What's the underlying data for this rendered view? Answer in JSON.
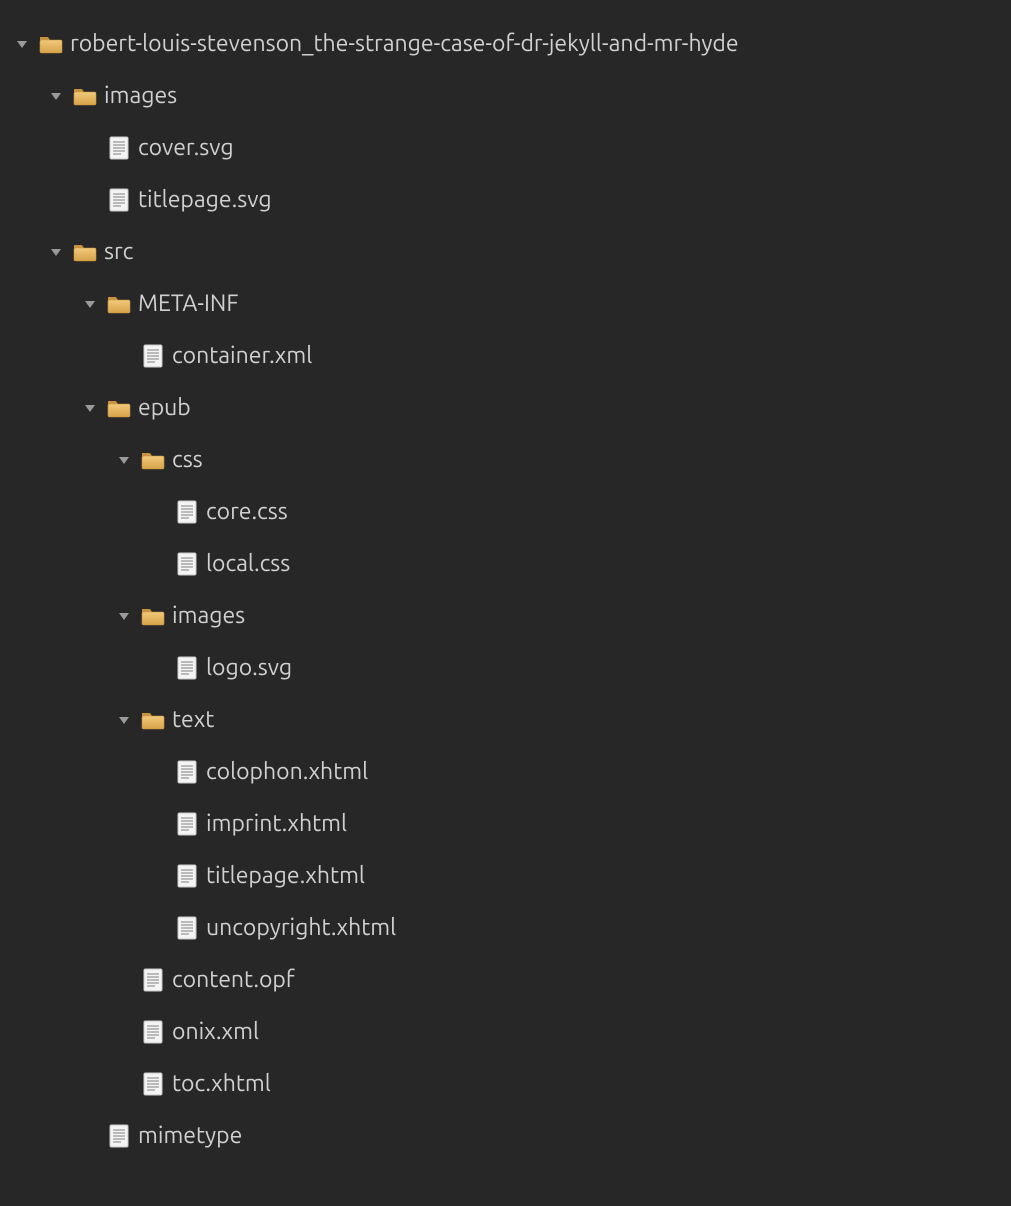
{
  "colors": {
    "background": "#272727",
    "text": "#d0d0d0",
    "toggle": "#9a9a9a",
    "folder_light": "#f0c97a",
    "folder_dark": "#d8a24a",
    "folder_tab": "#c8923e",
    "file_fill": "#f4f4f4",
    "file_border": "#c8c8c8",
    "file_lines": "#9a9a9a"
  },
  "tree": [
    {
      "depth": 0,
      "kind": "folder",
      "expanded": true,
      "label": "robert-louis-stevenson_the-strange-case-of-dr-jekyll-and-mr-hyde"
    },
    {
      "depth": 1,
      "kind": "folder",
      "expanded": true,
      "label": "images"
    },
    {
      "depth": 2,
      "kind": "file",
      "label": "cover.svg"
    },
    {
      "depth": 2,
      "kind": "file",
      "label": "titlepage.svg"
    },
    {
      "depth": 1,
      "kind": "folder",
      "expanded": true,
      "label": "src"
    },
    {
      "depth": 2,
      "kind": "folder",
      "expanded": true,
      "label": "META-INF"
    },
    {
      "depth": 3,
      "kind": "file",
      "label": "container.xml"
    },
    {
      "depth": 2,
      "kind": "folder",
      "expanded": true,
      "label": "epub"
    },
    {
      "depth": 3,
      "kind": "folder",
      "expanded": true,
      "label": "css"
    },
    {
      "depth": 4,
      "kind": "file",
      "label": "core.css"
    },
    {
      "depth": 4,
      "kind": "file",
      "label": "local.css"
    },
    {
      "depth": 3,
      "kind": "folder",
      "expanded": true,
      "label": "images"
    },
    {
      "depth": 4,
      "kind": "file",
      "label": "logo.svg"
    },
    {
      "depth": 3,
      "kind": "folder",
      "expanded": true,
      "label": "text"
    },
    {
      "depth": 4,
      "kind": "file",
      "label": "colophon.xhtml"
    },
    {
      "depth": 4,
      "kind": "file",
      "label": "imprint.xhtml"
    },
    {
      "depth": 4,
      "kind": "file",
      "label": "titlepage.xhtml"
    },
    {
      "depth": 4,
      "kind": "file",
      "label": "uncopyright.xhtml"
    },
    {
      "depth": 3,
      "kind": "file",
      "label": "content.opf"
    },
    {
      "depth": 3,
      "kind": "file",
      "label": "onix.xml"
    },
    {
      "depth": 3,
      "kind": "file",
      "label": "toc.xhtml"
    },
    {
      "depth": 2,
      "kind": "file",
      "label": "mimetype"
    }
  ]
}
